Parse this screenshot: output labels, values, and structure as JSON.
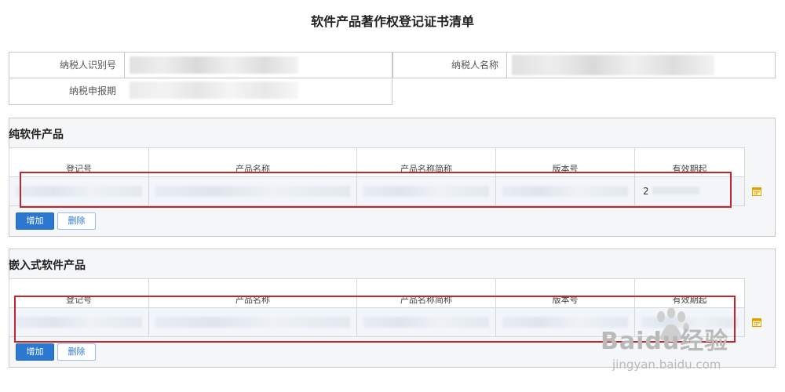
{
  "page_title": "软件产品著作权登记证书清单",
  "taxpayer": {
    "id_label": "纳税人识别号",
    "name_label": "纳税人名称",
    "period_label": "纳税申报期"
  },
  "pure_software": {
    "title": "纯软件产品",
    "columns": [
      "登记号",
      "产品名称",
      "产品名称简称",
      "版本号",
      "有效期起"
    ],
    "row": {
      "valid_from": "2"
    },
    "add_label": "增加",
    "delete_label": "删除"
  },
  "embedded_software": {
    "title": "嵌入式软件产品",
    "columns": [
      "登记号",
      "产品名称",
      "产品名称简称",
      "版本号",
      "有效期起"
    ],
    "add_label": "增加",
    "delete_label": "删除"
  },
  "watermark": {
    "logo": "Baidu经验",
    "url": "jingyan.baidu.com"
  },
  "colors": {
    "primary": "#2c78d0",
    "highlight": "#c0262b",
    "calendar_icon": "#e0a000"
  }
}
